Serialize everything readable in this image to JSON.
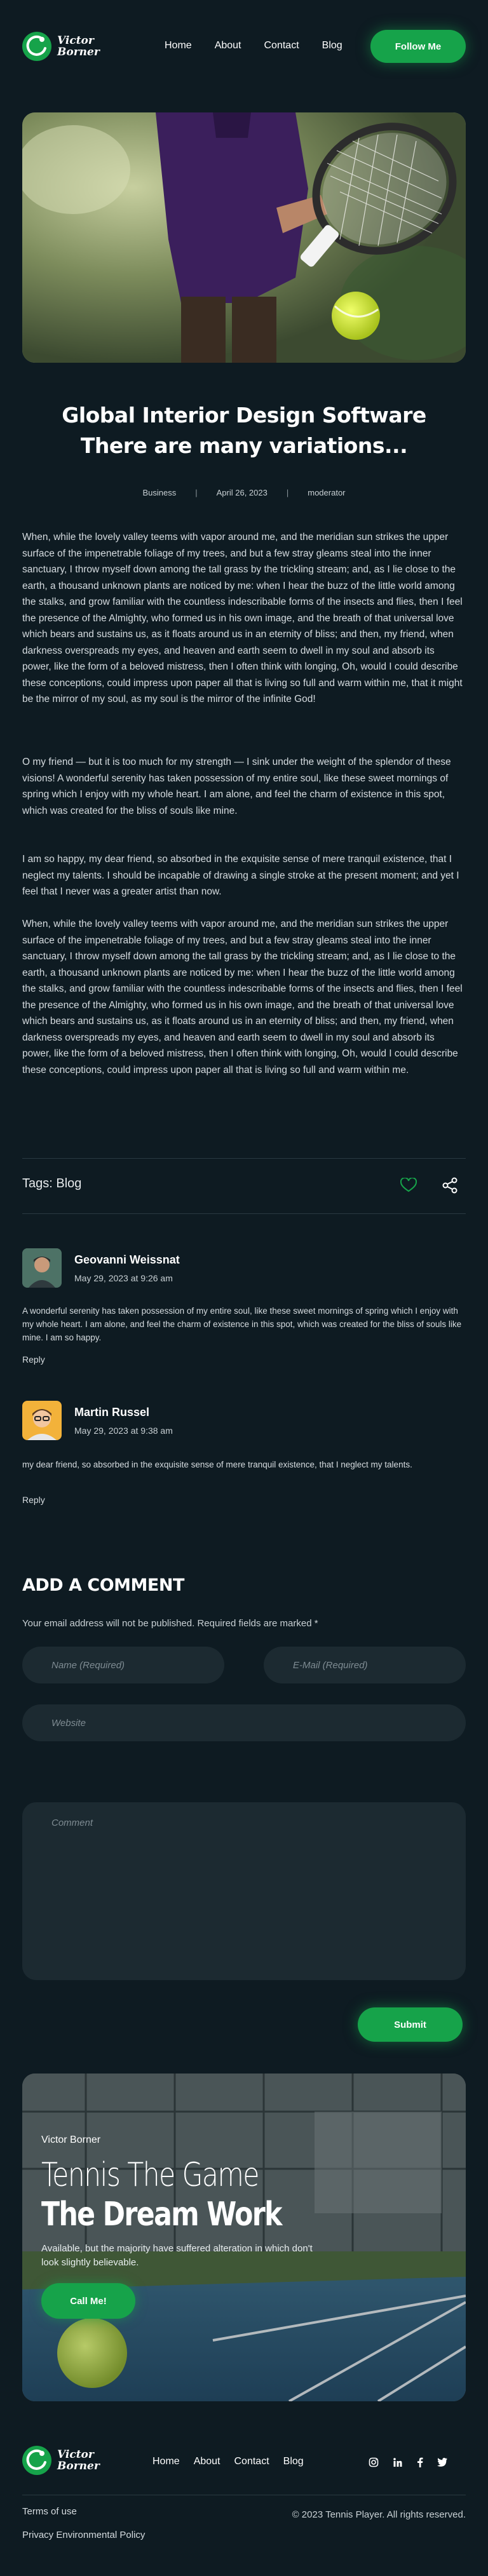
{
  "brand": {
    "name_line1": "Victor",
    "name_line2": "Borner",
    "accent": "#16a34a",
    "background": "#0e1b22"
  },
  "nav": {
    "items": [
      "Home",
      "About",
      "Contact",
      "Blog"
    ],
    "cta": "Follow Me"
  },
  "post": {
    "title": "Global Interior Design Software There are many variations...",
    "category": "Business",
    "date": "April 26, 2023",
    "author": "moderator",
    "paragraphs": [
      "When, while the lovely valley teems with vapor around me, and the meridian sun strikes the upper surface of the impenetrable foliage of my trees, and but a few stray gleams steal into the inner sanctuary, I throw myself down among the tall grass by the trickling stream; and, as I lie close to the earth, a thousand unknown plants are noticed by me: when I hear the buzz of the little world among the stalks, and grow familiar with the countless indescribable forms of the insects and flies, then I feel the presence of the Almighty, who formed us in his own image, and the breath of that universal love which bears and sustains us, as it floats around us in an eternity of bliss; and then, my friend, when darkness overspreads my eyes, and heaven and earth seem to dwell in my soul and absorb its power, like the form of a beloved mistress, then I often think with longing, Oh, would I could describe these conceptions, could impress upon paper all that is living so full and warm within me, that it might be the mirror of my soul, as my soul is the mirror of the infinite God!",
      "O my friend — but it is too much for my strength — I sink under the weight of the splendor of these visions! A wonderful serenity has taken possession of my entire soul, like these sweet mornings of spring which I enjoy with my whole heart. I am alone, and feel the charm of existence in this spot, which was created for the bliss of souls like mine.",
      "I am so happy, my dear friend, so absorbed in the exquisite sense of mere tranquil existence, that I neglect my talents. I should be incapable of drawing a single stroke at the present moment; and yet I feel that I never was a greater artist than now.",
      "When, while the lovely valley teems with vapor around me, and the meridian sun strikes the upper surface of the impenetrable foliage of my trees, and but a few stray gleams steal into the inner sanctuary, I throw myself down among the tall grass by the trickling stream; and, as I lie close to the earth, a thousand unknown plants are noticed by me: when I hear the buzz of the little world among the stalks, and grow familiar with the countless indescribable forms of the insects and flies, then I feel the presence of the Almighty, who formed us in his own image, and the breath of that universal love which bears and sustains us, as it floats around us in an eternity of bliss; and then, my friend, when darkness overspreads my eyes, and heaven and earth seem to dwell in my soul and absorb its power, like the form of a beloved mistress, then I often think with longing, Oh, would I could describe these conceptions, could impress upon paper all that is living so full and warm within me."
    ],
    "tags_label": "Tags: Blog"
  },
  "comments": [
    {
      "name": "Geovanni Weissnat",
      "date": "May 29, 2023 at 9:26 am",
      "text": "A wonderful serenity has taken possession of my entire soul, like these sweet mornings of spring which I enjoy with my whole heart. I am alone, and feel the charm of existence in this spot, which was created for the bliss of souls like mine. I am so happy.",
      "reply": "Reply"
    },
    {
      "name": "Martin Russel",
      "date": "May 29, 2023 at 9:38 am",
      "text": "my dear friend, so absorbed in the exquisite sense of mere tranquil existence, that I neglect my talents.",
      "reply": "Reply"
    }
  ],
  "comment_form": {
    "heading": "ADD A COMMENT",
    "required_note": "Your email address will not be published. Required fields are marked *",
    "name_placeholder": "Name (Required)",
    "email_placeholder": "E-Mail (Required)",
    "website_placeholder": "Website",
    "comment_placeholder": "Comment",
    "submit": "Submit"
  },
  "promo": {
    "subtitle": "Victor Borner",
    "title_line1": "Tennis The Game",
    "title_line2": "The Dream Work",
    "description": "Available, but the majority have suffered alteration in which don't look slightly believable.",
    "cta": "Call Me!"
  },
  "footer": {
    "nav": [
      "Home",
      "About",
      "Contact",
      "Blog"
    ],
    "social_icons": [
      "instagram-icon",
      "linkedin-icon",
      "facebook-icon",
      "twitter-icon"
    ],
    "terms": "Terms of use",
    "privacy": "Privacy Environmental Policy",
    "copyright": "© 2023 Tennis Player. All rights reserved."
  }
}
